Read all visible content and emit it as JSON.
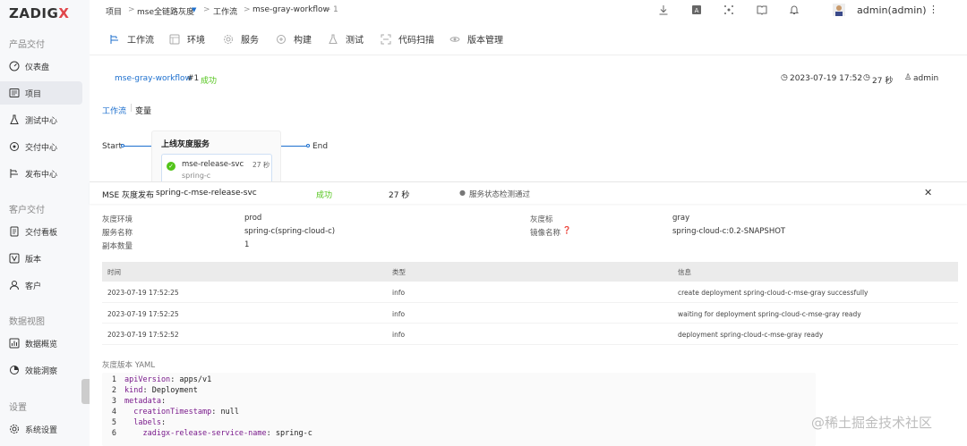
{
  "brand": {
    "logo": "ZADIGX"
  },
  "sidebar": {
    "sections": [
      {
        "title": "产品交付",
        "items": [
          {
            "label": "仪表盘",
            "icon": "dashboard-icon"
          },
          {
            "label": "项目",
            "icon": "project-icon",
            "active": true
          },
          {
            "label": "测试中心",
            "icon": "flask-icon"
          },
          {
            "label": "交付中心",
            "icon": "delivery-icon"
          },
          {
            "label": "发布中心",
            "icon": "release-icon"
          }
        ]
      },
      {
        "title": "客户交付",
        "items": [
          {
            "label": "交付看板",
            "icon": "board-icon"
          },
          {
            "label": "版本",
            "icon": "version-icon"
          },
          {
            "label": "客户",
            "icon": "customer-icon"
          }
        ]
      },
      {
        "title": "数据视图",
        "items": [
          {
            "label": "数据概览",
            "icon": "chart-icon"
          },
          {
            "label": "效能洞察",
            "icon": "insight-icon"
          }
        ]
      },
      {
        "title": "设置",
        "items": [
          {
            "label": "系统设置",
            "icon": "settings-icon"
          }
        ]
      }
    ]
  },
  "breadcrumb": {
    "items": [
      "项目",
      "mse全链路灰度",
      "工作流",
      "mse-gray-workflow",
      "1"
    ]
  },
  "user": {
    "name": "admin(admin)"
  },
  "tabs": [
    {
      "label": "工作流",
      "icon": "workflow-icon"
    },
    {
      "label": "环境",
      "icon": "env-icon"
    },
    {
      "label": "服务",
      "icon": "service-icon"
    },
    {
      "label": "构建",
      "icon": "build-icon"
    },
    {
      "label": "测试",
      "icon": "test-icon"
    },
    {
      "label": "代码扫描",
      "icon": "scan-icon"
    },
    {
      "label": "版本管理",
      "icon": "eye-icon"
    }
  ],
  "run": {
    "workflow": "mse-gray-workflow",
    "number": "#1",
    "status": "成功",
    "time": "2023-07-19 17:52",
    "duration": "27 秒",
    "user": "admin"
  },
  "subtabs": {
    "workflow": "工作流",
    "variables": "变量"
  },
  "flow": {
    "start": "Start",
    "end": "End",
    "stage_title": "上线灰度服务",
    "job_name": "mse-release-svc",
    "job_service": "spring-c",
    "job_duration": "27 秒"
  },
  "panel": {
    "title": "MSE 灰度发布",
    "job": "spring-c-mse-release-svc",
    "status": "成功",
    "duration": "27 秒",
    "check": "服务状态检测通过",
    "fields_left": [
      {
        "label": "灰度环境",
        "value": "prod",
        "link": true
      },
      {
        "label": "服务名称",
        "value": "spring-c(spring-cloud-c)",
        "link": true
      },
      {
        "label": "副本数量",
        "value": "1",
        "link": false
      }
    ],
    "fields_right": [
      {
        "label": "灰度标",
        "value": "gray"
      },
      {
        "label": "镜像名称",
        "value": "spring-cloud-c:0.2-SNAPSHOT"
      }
    ]
  },
  "table": {
    "headers": [
      "时间",
      "类型",
      "信息"
    ],
    "rows": [
      [
        "2023-07-19 17:52:25",
        "info",
        "create deployment spring-cloud-c-mse-gray successfully"
      ],
      [
        "2023-07-19 17:52:25",
        "info",
        "waiting for deployment spring-cloud-c-mse-gray ready"
      ],
      [
        "2023-07-19 17:52:52",
        "info",
        "deployment spring-cloud-c-mse-gray ready"
      ]
    ]
  },
  "yaml": {
    "title": "灰度版本 YAML",
    "lines": [
      "apiVersion: apps/v1",
      "kind: Deployment",
      "metadata:",
      "  creationTimestamp: null",
      "  labels:",
      "    zadigx-release-service-name: spring-c"
    ]
  },
  "watermark": "@稀土掘金技术社区",
  "colors": {
    "link": "#1c6fce",
    "success": "#52c41a",
    "brand_x": "#e0464b"
  }
}
